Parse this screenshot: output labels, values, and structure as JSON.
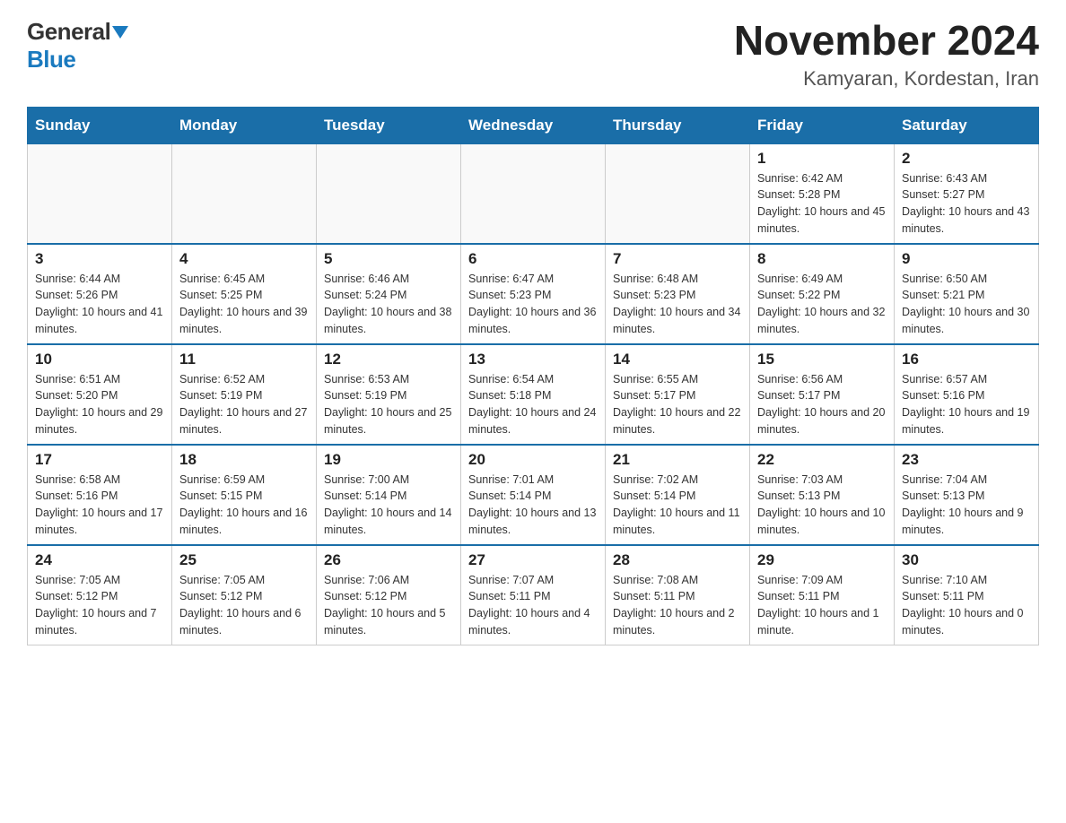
{
  "logo": {
    "general": "General",
    "blue": "Blue"
  },
  "title": "November 2024",
  "subtitle": "Kamyaran, Kordestan, Iran",
  "days_of_week": [
    "Sunday",
    "Monday",
    "Tuesday",
    "Wednesday",
    "Thursday",
    "Friday",
    "Saturday"
  ],
  "weeks": [
    [
      {
        "day": "",
        "info": ""
      },
      {
        "day": "",
        "info": ""
      },
      {
        "day": "",
        "info": ""
      },
      {
        "day": "",
        "info": ""
      },
      {
        "day": "",
        "info": ""
      },
      {
        "day": "1",
        "info": "Sunrise: 6:42 AM\nSunset: 5:28 PM\nDaylight: 10 hours and 45 minutes."
      },
      {
        "day": "2",
        "info": "Sunrise: 6:43 AM\nSunset: 5:27 PM\nDaylight: 10 hours and 43 minutes."
      }
    ],
    [
      {
        "day": "3",
        "info": "Sunrise: 6:44 AM\nSunset: 5:26 PM\nDaylight: 10 hours and 41 minutes."
      },
      {
        "day": "4",
        "info": "Sunrise: 6:45 AM\nSunset: 5:25 PM\nDaylight: 10 hours and 39 minutes."
      },
      {
        "day": "5",
        "info": "Sunrise: 6:46 AM\nSunset: 5:24 PM\nDaylight: 10 hours and 38 minutes."
      },
      {
        "day": "6",
        "info": "Sunrise: 6:47 AM\nSunset: 5:23 PM\nDaylight: 10 hours and 36 minutes."
      },
      {
        "day": "7",
        "info": "Sunrise: 6:48 AM\nSunset: 5:23 PM\nDaylight: 10 hours and 34 minutes."
      },
      {
        "day": "8",
        "info": "Sunrise: 6:49 AM\nSunset: 5:22 PM\nDaylight: 10 hours and 32 minutes."
      },
      {
        "day": "9",
        "info": "Sunrise: 6:50 AM\nSunset: 5:21 PM\nDaylight: 10 hours and 30 minutes."
      }
    ],
    [
      {
        "day": "10",
        "info": "Sunrise: 6:51 AM\nSunset: 5:20 PM\nDaylight: 10 hours and 29 minutes."
      },
      {
        "day": "11",
        "info": "Sunrise: 6:52 AM\nSunset: 5:19 PM\nDaylight: 10 hours and 27 minutes."
      },
      {
        "day": "12",
        "info": "Sunrise: 6:53 AM\nSunset: 5:19 PM\nDaylight: 10 hours and 25 minutes."
      },
      {
        "day": "13",
        "info": "Sunrise: 6:54 AM\nSunset: 5:18 PM\nDaylight: 10 hours and 24 minutes."
      },
      {
        "day": "14",
        "info": "Sunrise: 6:55 AM\nSunset: 5:17 PM\nDaylight: 10 hours and 22 minutes."
      },
      {
        "day": "15",
        "info": "Sunrise: 6:56 AM\nSunset: 5:17 PM\nDaylight: 10 hours and 20 minutes."
      },
      {
        "day": "16",
        "info": "Sunrise: 6:57 AM\nSunset: 5:16 PM\nDaylight: 10 hours and 19 minutes."
      }
    ],
    [
      {
        "day": "17",
        "info": "Sunrise: 6:58 AM\nSunset: 5:16 PM\nDaylight: 10 hours and 17 minutes."
      },
      {
        "day": "18",
        "info": "Sunrise: 6:59 AM\nSunset: 5:15 PM\nDaylight: 10 hours and 16 minutes."
      },
      {
        "day": "19",
        "info": "Sunrise: 7:00 AM\nSunset: 5:14 PM\nDaylight: 10 hours and 14 minutes."
      },
      {
        "day": "20",
        "info": "Sunrise: 7:01 AM\nSunset: 5:14 PM\nDaylight: 10 hours and 13 minutes."
      },
      {
        "day": "21",
        "info": "Sunrise: 7:02 AM\nSunset: 5:14 PM\nDaylight: 10 hours and 11 minutes."
      },
      {
        "day": "22",
        "info": "Sunrise: 7:03 AM\nSunset: 5:13 PM\nDaylight: 10 hours and 10 minutes."
      },
      {
        "day": "23",
        "info": "Sunrise: 7:04 AM\nSunset: 5:13 PM\nDaylight: 10 hours and 9 minutes."
      }
    ],
    [
      {
        "day": "24",
        "info": "Sunrise: 7:05 AM\nSunset: 5:12 PM\nDaylight: 10 hours and 7 minutes."
      },
      {
        "day": "25",
        "info": "Sunrise: 7:05 AM\nSunset: 5:12 PM\nDaylight: 10 hours and 6 minutes."
      },
      {
        "day": "26",
        "info": "Sunrise: 7:06 AM\nSunset: 5:12 PM\nDaylight: 10 hours and 5 minutes."
      },
      {
        "day": "27",
        "info": "Sunrise: 7:07 AM\nSunset: 5:11 PM\nDaylight: 10 hours and 4 minutes."
      },
      {
        "day": "28",
        "info": "Sunrise: 7:08 AM\nSunset: 5:11 PM\nDaylight: 10 hours and 2 minutes."
      },
      {
        "day": "29",
        "info": "Sunrise: 7:09 AM\nSunset: 5:11 PM\nDaylight: 10 hours and 1 minute."
      },
      {
        "day": "30",
        "info": "Sunrise: 7:10 AM\nSunset: 5:11 PM\nDaylight: 10 hours and 0 minutes."
      }
    ]
  ]
}
